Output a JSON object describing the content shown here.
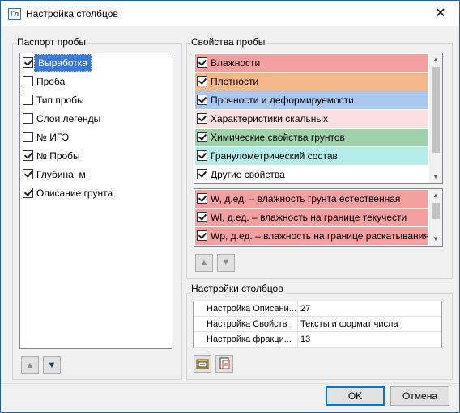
{
  "window": {
    "title": "Настройка столбцов",
    "icon_label": "Гл"
  },
  "passport": {
    "title": "Паспорт пробы",
    "items": [
      {
        "label": "Выработка",
        "checked": true,
        "selected": true
      },
      {
        "label": "Проба",
        "checked": false
      },
      {
        "label": "Тип пробы",
        "checked": false
      },
      {
        "label": "Слои легенды",
        "checked": false
      },
      {
        "label": "№ ИГЭ",
        "checked": false
      },
      {
        "label": "№ Пробы",
        "checked": true
      },
      {
        "label": "Глубина, м",
        "checked": true
      },
      {
        "label": "Описание грунта",
        "checked": true
      }
    ]
  },
  "properties": {
    "title": "Свойства пробы",
    "groups": [
      {
        "label": "Влажности",
        "checked": true,
        "color": "#f4a0a0"
      },
      {
        "label": "Плотности",
        "checked": true,
        "color": "#f5b88a"
      },
      {
        "label": "Прочности и деформируемости",
        "checked": true,
        "color": "#a8c8f0"
      },
      {
        "label": "Характеристики скальных",
        "checked": true,
        "color": "#fbe0e0"
      },
      {
        "label": "Химические свойства грунтов",
        "checked": true,
        "color": "#9fd2a8"
      },
      {
        "label": "Гранулометрический состав",
        "checked": true,
        "color": "#b4ece8"
      },
      {
        "label": "Другие свойства",
        "checked": true,
        "color": "#ffffff"
      }
    ],
    "columns": [
      {
        "label": "W, д.ед. – влажность грунта естественная",
        "checked": true,
        "color": "#f4a0a0"
      },
      {
        "label": "Wl, д.ед.  – влажность на границе текучести",
        "checked": true,
        "color": "#f4a0a0"
      },
      {
        "label": "Wp, д.ед. – влажность на границе раскатывания",
        "checked": true,
        "color": "#f4a0a0"
      }
    ]
  },
  "settings": {
    "title": "Настройки столбцов",
    "rows": [
      {
        "name": "Настройка Описани...",
        "value": "27"
      },
      {
        "name": "Настройка Свойств",
        "value": "Тексты и формат числа"
      },
      {
        "name": "Настройка фракци...",
        "value": "13"
      }
    ]
  },
  "buttons": {
    "ok": "OK",
    "cancel": "Отмена"
  }
}
